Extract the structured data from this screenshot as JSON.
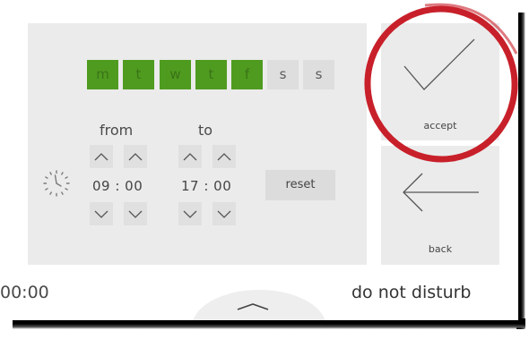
{
  "days": [
    {
      "label": "m",
      "active": true
    },
    {
      "label": "t",
      "active": true
    },
    {
      "label": "w",
      "active": true
    },
    {
      "label": "t",
      "active": true
    },
    {
      "label": "f",
      "active": true
    },
    {
      "label": "s",
      "active": false
    },
    {
      "label": "s",
      "active": false
    }
  ],
  "schedule": {
    "from_label": "from",
    "to_label": "to",
    "from_time": "09 : 00",
    "to_time": "17 : 00"
  },
  "buttons": {
    "reset": "reset",
    "accept": "accept",
    "back": "back"
  },
  "status": {
    "time": "00:00",
    "mode": "do not disturb"
  },
  "icons": {
    "clock": "clock-icon",
    "accept": "checkmark-icon",
    "back": "arrow-left-icon",
    "up": "chevron-up-icon",
    "down": "chevron-down-icon",
    "handle": "chevron-up-icon"
  },
  "colors": {
    "active_day": "#4f9b1f",
    "inactive_day": "#dedede",
    "panel": "#ebebeb",
    "highlight_ring": "#c8202a"
  }
}
